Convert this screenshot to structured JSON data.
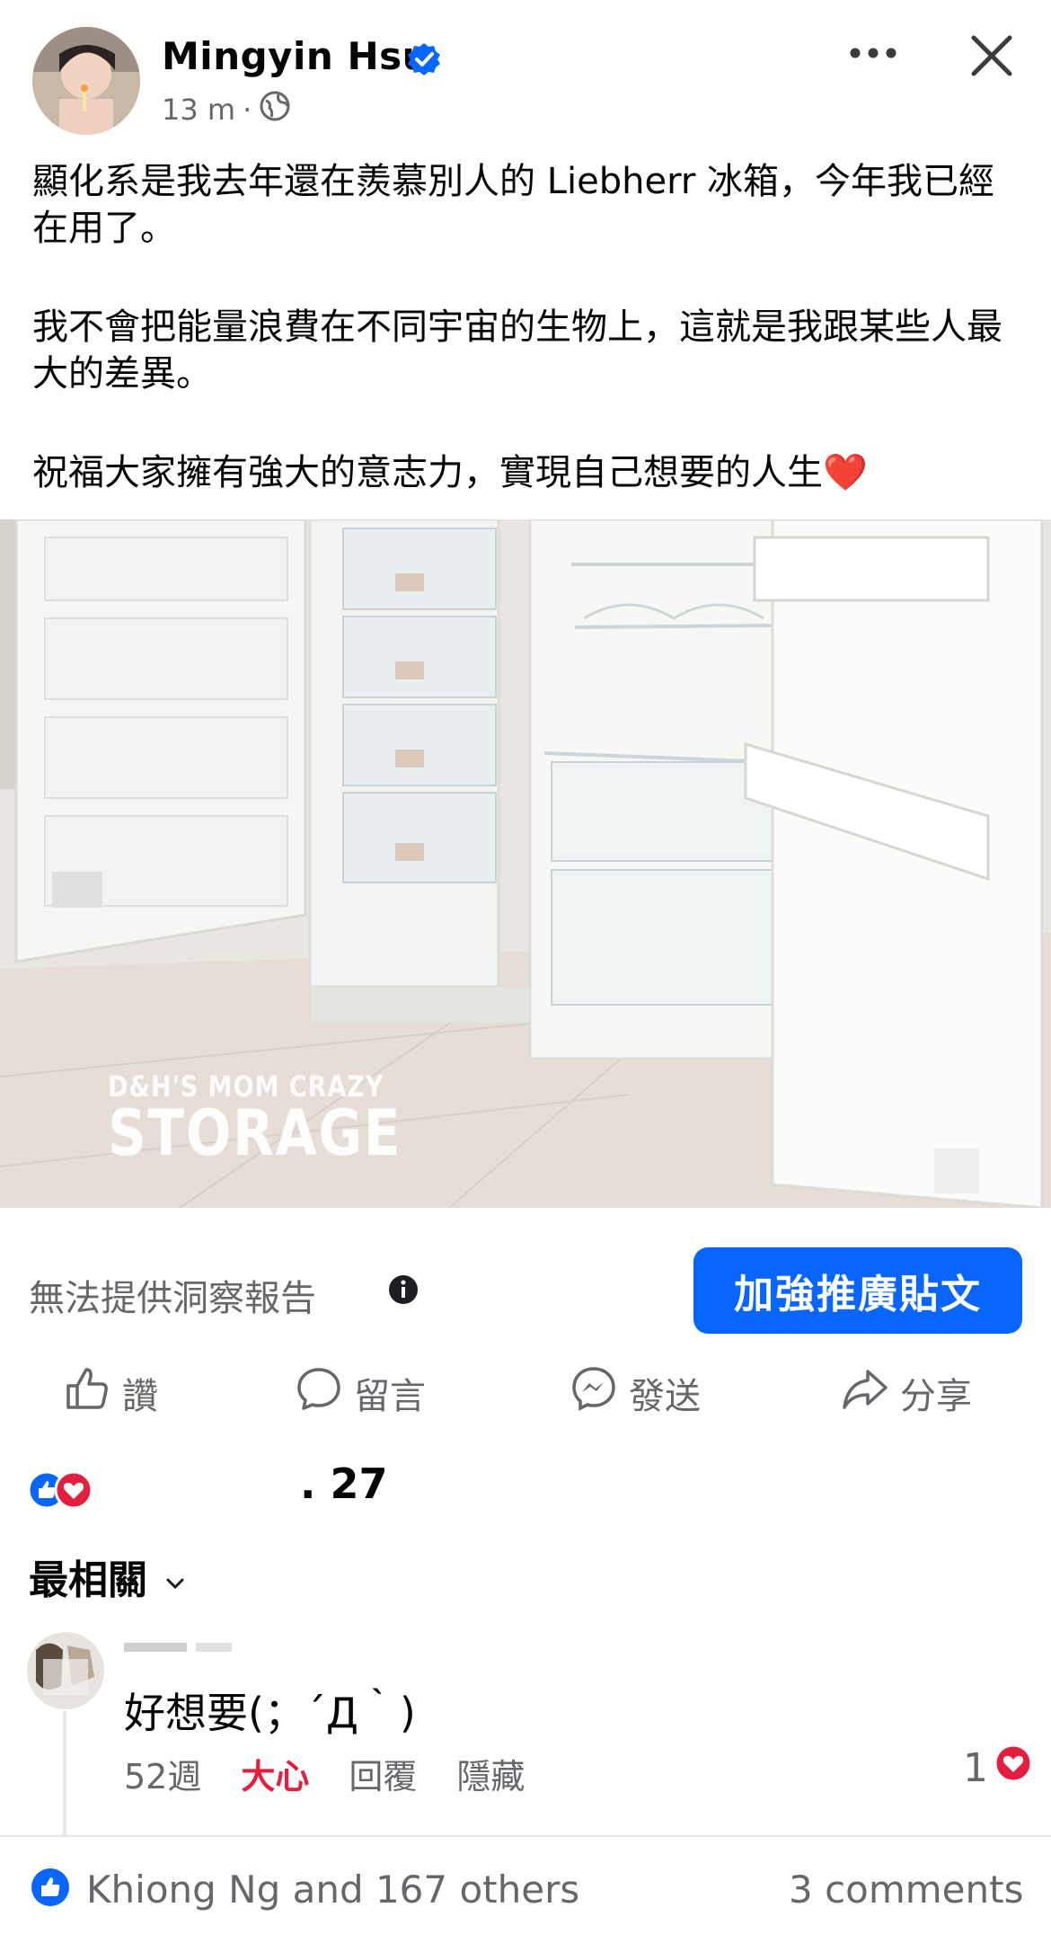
{
  "post": {
    "author": "Mingyin Hsu",
    "time": "13 m",
    "dot": "·",
    "paragraphs": [
      "顯化系是我去年還在羨慕別人的 Liebherr 冰箱，今年我已經在用了。",
      "我不會把能量浪費在不同宇宙的生物上，這就是我跟某些人最大的差異。",
      "祝福大家擁有強大的意志力，實現自己想要的人生"
    ],
    "heart_emoji": "❤️",
    "photo": {
      "watermark_line1": "D&H'S MOM CRAZY",
      "watermark_line2": "STORAGE"
    }
  },
  "insights": {
    "text": "無法提供洞察報告",
    "boost_label": "加強推廣貼文"
  },
  "actions": {
    "like": "讚",
    "comment": "留言",
    "send": "發送",
    "share": "分享"
  },
  "reactions": {
    "count": ". 27"
  },
  "sort": {
    "label": "最相關"
  },
  "comment": {
    "text": "好想要(；´Д｀)",
    "time": "52週",
    "reaction": "大心",
    "reply": "回覆",
    "hide": "隱藏",
    "likes": "1"
  },
  "footer": {
    "likes_text": "Khiong Ng and 167 others",
    "comments_text": "3 comments"
  },
  "colors": {
    "accent": "#0866ff",
    "heart": "#e41e3f",
    "muted_text": "#65676b"
  },
  "icons": [
    "verified-badge-icon",
    "globe-icon",
    "more-icon",
    "close-icon",
    "info-icon",
    "thumbs-up-icon",
    "comment-icon",
    "messenger-icon",
    "share-icon",
    "chevron-down-icon",
    "heart-icon"
  ]
}
